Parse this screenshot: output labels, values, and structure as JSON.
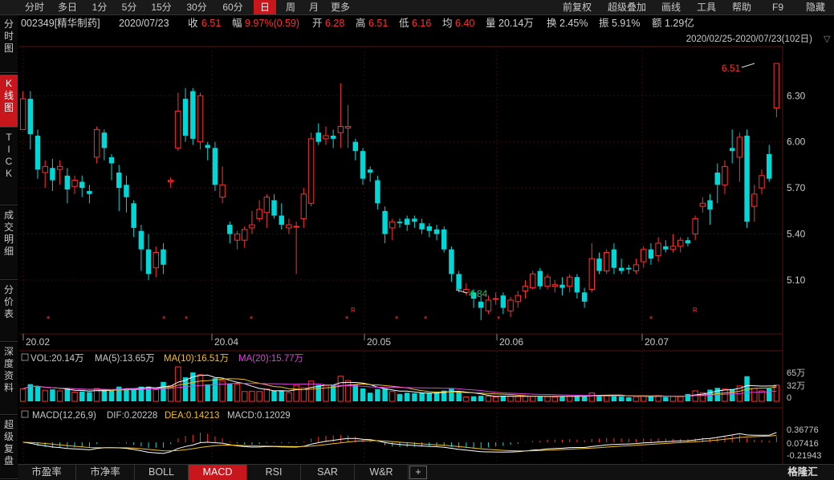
{
  "tabs": [
    "分时",
    "多日",
    "1分",
    "5分",
    "15分",
    "30分",
    "60分",
    "日",
    "周",
    "月",
    "更多"
  ],
  "active_tab": "日",
  "right_tabs": [
    "前复权",
    "超级叠加",
    "画线",
    "工具",
    "帮助",
    "F9",
    "隐藏"
  ],
  "info": {
    "code_name": "002349[精华制药]",
    "date": "2020/07/23",
    "close_label": "收",
    "close": "6.51",
    "amp_label": "幅",
    "amp": "9.97%(0.59)",
    "open_label": "开",
    "open": "6.28",
    "high_label": "高",
    "high": "6.51",
    "low_label": "低",
    "low": "6.16",
    "avg_label": "均",
    "avg": "6.40",
    "vol_label": "量",
    "vol": "20.14万",
    "turnover_label": "换",
    "turnover": "2.45%",
    "swing_label": "振",
    "swing": "5.91%",
    "amount_label": "额",
    "amount": "1.29亿"
  },
  "range_label": "2020/02/25-2020/07/23(102日)",
  "side_nav": [
    "分时图",
    "K线图",
    "TICK",
    "成交明细",
    "分价表",
    "深度资料",
    "超级复盘"
  ],
  "side_active": "K线图",
  "price_axis": [
    "6.30",
    "6.00",
    "5.70",
    "5.40",
    "5.10"
  ],
  "date_axis": [
    "20.02",
    "20.04",
    "20.05",
    "20.06",
    "20.07"
  ],
  "annotations": {
    "high": "6.51",
    "low": "4.84"
  },
  "volume": {
    "label": "VOL:20.14万",
    "ma5": "MA(5):13.65万",
    "ma10": "MA(10):16.51万",
    "ma20": "MA(20):15.77万",
    "axis": [
      "65万",
      "32万",
      "0"
    ]
  },
  "macd": {
    "label": "MACD(12,26,9)",
    "dif": "DIF:0.20228",
    "dea": "DEA:0.14213",
    "macd": "MACD:0.12029",
    "axis": [
      "0.36776",
      "0.07416",
      "-0.21943"
    ]
  },
  "bottom_tabs": [
    "市盈率",
    "市净率",
    "BOLL",
    "MACD",
    "RSI",
    "SAR",
    "W&R"
  ],
  "bottom_active": "MACD",
  "add_symbol": "+",
  "watermark": "格隆汇",
  "colors": {
    "up": "#ff3030",
    "down": "#00d8d8",
    "ma5": "#ffffff",
    "ma10": "#f0c020",
    "ma20": "#e040e0",
    "active": "#c8161d"
  },
  "chart_data": {
    "type": "candlestick",
    "ylim": [
      4.75,
      6.62
    ],
    "candles": [
      [
        6.08,
        6.28,
        6.1,
        6.33
      ],
      [
        6.28,
        6.05,
        5.95,
        6.33
      ],
      [
        6.04,
        5.82,
        5.76,
        6.08
      ],
      [
        5.8,
        5.84,
        5.7,
        5.88
      ],
      [
        5.83,
        5.75,
        5.68,
        5.89
      ],
      [
        5.82,
        5.84,
        5.72,
        5.88
      ],
      [
        5.78,
        5.69,
        5.6,
        5.83
      ],
      [
        5.71,
        5.75,
        5.66,
        5.78
      ],
      [
        5.74,
        5.7,
        5.64,
        5.78
      ],
      [
        5.68,
        5.66,
        5.6,
        5.72
      ],
      [
        5.9,
        6.08,
        5.86,
        6.1
      ],
      [
        6.06,
        5.96,
        5.88,
        6.08
      ],
      [
        5.9,
        5.86,
        5.75,
        5.92
      ],
      [
        5.8,
        5.7,
        5.55,
        5.85
      ],
      [
        5.72,
        5.64,
        5.54,
        5.78
      ],
      [
        5.6,
        5.44,
        5.38,
        5.62
      ],
      [
        5.42,
        5.3,
        5.16,
        5.46
      ],
      [
        5.3,
        5.14,
        5.1,
        5.4
      ],
      [
        5.18,
        5.28,
        5.12,
        5.32
      ],
      [
        5.3,
        5.2,
        5.14,
        5.34
      ],
      [
        5.74,
        5.75,
        5.7,
        5.77
      ],
      [
        5.96,
        6.2,
        5.94,
        6.32
      ],
      [
        6.28,
        6.04,
        6.0,
        6.35
      ],
      [
        6.33,
        6.02,
        5.98,
        6.35
      ],
      [
        6.0,
        6.3,
        5.95,
        6.32
      ],
      [
        5.98,
        5.96,
        5.88,
        6.0
      ],
      [
        5.96,
        5.72,
        5.68,
        6.0
      ],
      [
        5.64,
        5.72,
        5.6,
        5.84
      ],
      [
        5.46,
        5.4,
        5.34,
        5.48
      ],
      [
        5.36,
        5.4,
        5.3,
        5.42
      ],
      [
        5.36,
        5.43,
        5.31,
        5.45
      ],
      [
        5.44,
        5.46,
        5.4,
        5.55
      ],
      [
        5.5,
        5.56,
        5.48,
        5.62
      ],
      [
        5.54,
        5.64,
        5.44,
        5.66
      ],
      [
        5.62,
        5.52,
        5.5,
        5.66
      ],
      [
        5.52,
        5.46,
        5.43,
        5.6
      ],
      [
        5.44,
        5.46,
        5.4,
        5.5
      ],
      [
        5.45,
        5.45,
        5.14,
        5.48
      ],
      [
        5.5,
        5.66,
        5.44,
        5.7
      ],
      [
        5.6,
        6.02,
        5.58,
        6.06
      ],
      [
        6.06,
        6.0,
        5.98,
        6.12
      ],
      [
        6.02,
        6.04,
        5.98,
        6.1
      ],
      [
        6.04,
        6.02,
        5.96,
        6.08
      ],
      [
        6.06,
        6.1,
        5.96,
        6.38
      ],
      [
        6.09,
        6.1,
        5.96,
        6.24
      ],
      [
        6.0,
        5.94,
        5.88,
        6.02
      ],
      [
        5.94,
        5.76,
        5.72,
        5.96
      ],
      [
        5.82,
        5.8,
        5.74,
        5.84
      ],
      [
        5.75,
        5.6,
        5.56,
        5.78
      ],
      [
        5.55,
        5.4,
        5.34,
        5.58
      ],
      [
        5.44,
        5.48,
        5.36,
        5.5
      ],
      [
        5.48,
        5.47,
        5.44,
        5.5
      ],
      [
        5.5,
        5.46,
        5.42,
        5.52
      ],
      [
        5.5,
        5.48,
        5.44,
        5.52
      ],
      [
        5.47,
        5.43,
        5.4,
        5.5
      ],
      [
        5.45,
        5.42,
        5.38,
        5.47
      ],
      [
        5.43,
        5.4,
        5.36,
        5.46
      ],
      [
        5.43,
        5.3,
        5.28,
        5.45
      ],
      [
        5.3,
        5.14,
        5.09,
        5.32
      ],
      [
        5.14,
        5.04,
        5.02,
        5.16
      ],
      [
        5.02,
        5.04,
        5.0,
        5.08
      ],
      [
        5.02,
        4.98,
        4.92,
        5.04
      ],
      [
        4.96,
        4.92,
        4.84,
        4.99
      ],
      [
        4.9,
        4.97,
        4.88,
        5.0
      ],
      [
        4.98,
        4.98,
        4.94,
        5.02
      ],
      [
        5.0,
        4.92,
        4.88,
        5.02
      ],
      [
        4.9,
        4.97,
        4.86,
        4.99
      ],
      [
        4.96,
        5.0,
        4.92,
        5.03
      ],
      [
        5.03,
        5.06,
        4.98,
        5.1
      ],
      [
        5.05,
        5.14,
        5.04,
        5.16
      ],
      [
        5.16,
        5.06,
        5.04,
        5.18
      ],
      [
        5.06,
        5.12,
        5.04,
        5.14
      ],
      [
        5.06,
        5.07,
        5.02,
        5.1
      ],
      [
        5.07,
        5.05,
        5.0,
        5.12
      ],
      [
        5.06,
        5.12,
        5.02,
        5.14
      ],
      [
        5.12,
        5.02,
        4.98,
        5.14
      ],
      [
        5.02,
        4.96,
        4.92,
        5.05
      ],
      [
        5.04,
        5.24,
        5.02,
        5.34
      ],
      [
        5.24,
        5.16,
        5.14,
        5.28
      ],
      [
        5.16,
        5.28,
        5.14,
        5.3
      ],
      [
        5.3,
        5.18,
        5.14,
        5.34
      ],
      [
        5.18,
        5.16,
        5.14,
        5.24
      ],
      [
        5.18,
        5.17,
        5.14,
        5.2
      ],
      [
        5.16,
        5.2,
        5.14,
        5.24
      ],
      [
        5.22,
        5.3,
        5.18,
        5.32
      ],
      [
        5.3,
        5.24,
        5.2,
        5.34
      ],
      [
        5.26,
        5.34,
        5.22,
        5.38
      ],
      [
        5.32,
        5.3,
        5.28,
        5.36
      ],
      [
        5.3,
        5.32,
        5.28,
        5.4
      ],
      [
        5.32,
        5.36,
        5.28,
        5.38
      ],
      [
        5.36,
        5.34,
        5.32,
        5.38
      ],
      [
        5.4,
        5.5,
        5.36,
        5.52
      ],
      [
        5.58,
        5.6,
        5.54,
        5.64
      ],
      [
        5.62,
        5.56,
        5.46,
        5.66
      ],
      [
        5.8,
        5.72,
        5.6,
        5.86
      ],
      [
        5.72,
        5.84,
        5.66,
        5.88
      ],
      [
        5.96,
        5.94,
        5.86,
        6.08
      ],
      [
        5.9,
        6.03,
        5.74,
        6.06
      ],
      [
        6.04,
        5.48,
        5.44,
        6.08
      ],
      [
        5.58,
        5.66,
        5.48,
        5.72
      ],
      [
        5.7,
        5.78,
        5.66,
        5.82
      ],
      [
        5.92,
        5.76,
        5.74,
        5.98
      ],
      [
        6.22,
        6.51,
        6.16,
        6.51
      ]
    ]
  }
}
